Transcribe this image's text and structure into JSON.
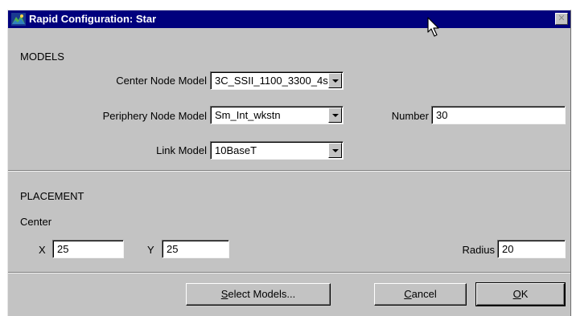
{
  "window": {
    "title": "Rapid Configuration: Star",
    "close_glyph": "✕"
  },
  "models": {
    "section_title": "MODELS",
    "center_node": {
      "label": "Center Node Model",
      "value": "3C_SSII_1100_3300_4s"
    },
    "periphery_node": {
      "label": "Periphery Node Model",
      "value": "Sm_Int_wkstn"
    },
    "number": {
      "label": "Number",
      "value": "30"
    },
    "link": {
      "label": "Link Model",
      "value": "10BaseT"
    }
  },
  "placement": {
    "section_title": "PLACEMENT",
    "center_label": "Center",
    "x": {
      "label": "X",
      "value": "25"
    },
    "y": {
      "label": "Y",
      "value": "25"
    },
    "radius": {
      "label": "Radius",
      "value": "20"
    }
  },
  "buttons": {
    "select_models": {
      "mnemonic": "S",
      "rest": "elect Models..."
    },
    "cancel": {
      "mnemonic": "C",
      "rest": "ancel"
    },
    "ok": {
      "mnemonic": "O",
      "rest": "K"
    }
  },
  "icons": {
    "title_icon": "network-app-icon",
    "close_icon": "close-icon",
    "cursor": "mouse-pointer-icon",
    "dropdown": "dropdown-arrow-icon"
  },
  "colors": {
    "titlebar": "#00007d",
    "dialog_bg": "#c3c3c3",
    "field_bg": "#ffffff"
  }
}
